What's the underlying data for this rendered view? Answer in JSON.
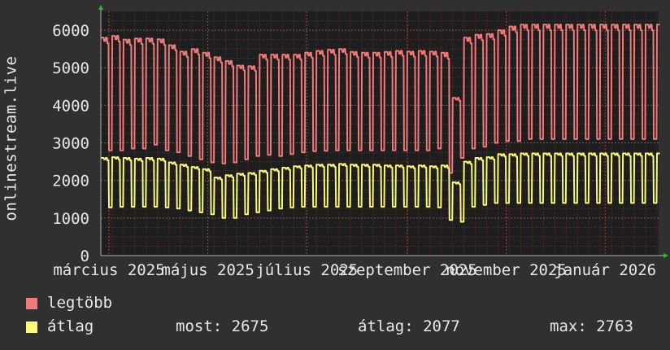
{
  "chart_data": {
    "type": "line",
    "ylabel": "onlinestream.live",
    "ylim": [
      0,
      6500
    ],
    "y_ticks": [
      "0",
      "1000",
      "2000",
      "3000",
      "4000",
      "5000",
      "6000"
    ],
    "x_ticks": [
      "március 2025",
      "május 2025",
      "július 2025",
      "szeptember 2025",
      "november 2025",
      "január 2026"
    ],
    "x_tick_days": [
      5,
      66,
      127,
      189,
      250,
      311
    ],
    "x_range_days": [
      0,
      344
    ],
    "grid": true,
    "series": [
      {
        "name": "legtöbb",
        "color": "#f07a7a",
        "weekly_high": [
          5800,
          5850,
          5750,
          5780,
          5780,
          5760,
          5600,
          5430,
          5500,
          5400,
          5280,
          5180,
          5060,
          5040,
          5350,
          5350,
          5350,
          5350,
          5400,
          5450,
          5480,
          5500,
          5420,
          5400,
          5400,
          5420,
          5450,
          5430,
          5450,
          5430,
          5400,
          4200,
          5800,
          5880,
          5900,
          6000,
          6100,
          6150,
          6150
        ],
        "weekly_low": [
          2800,
          2800,
          2850,
          2850,
          2950,
          2800,
          2750,
          2650,
          2560,
          2480,
          2450,
          2480,
          2560,
          2650,
          2680,
          2650,
          2700,
          2750,
          2780,
          2790,
          2800,
          2800,
          2800,
          2800,
          2800,
          2800,
          2800,
          2800,
          2800,
          2850,
          2200,
          2600,
          2850,
          2900,
          3000,
          3050,
          3050,
          3100,
          3100
        ]
      },
      {
        "name": "átlag",
        "color": "#fafa78",
        "weekly_high": [
          2600,
          2620,
          2600,
          2580,
          2600,
          2580,
          2480,
          2420,
          2360,
          2300,
          2080,
          2140,
          2180,
          2200,
          2260,
          2300,
          2340,
          2380,
          2400,
          2420,
          2420,
          2440,
          2420,
          2420,
          2420,
          2400,
          2400,
          2380,
          2400,
          2380,
          2400,
          1950,
          2500,
          2600,
          2620,
          2700,
          2700,
          2720,
          2720
        ],
        "weekly_low": [
          1280,
          1300,
          1300,
          1300,
          1300,
          1280,
          1250,
          1200,
          1150,
          1100,
          1000,
          1000,
          1100,
          1150,
          1200,
          1250,
          1280,
          1300,
          1300,
          1300,
          1300,
          1300,
          1300,
          1300,
          1300,
          1300,
          1300,
          1300,
          1300,
          1280,
          950,
          900,
          1300,
          1350,
          1400,
          1400,
          1400,
          1400,
          1400
        ]
      }
    ]
  },
  "legend": {
    "items": [
      {
        "label": "legtöbb",
        "color": "#f07a7a"
      },
      {
        "label": "átlag",
        "color": "#fafa78"
      }
    ],
    "stats": {
      "most": "most: 2675",
      "atlag": "átlag: 2077",
      "max": "max: 2763"
    }
  },
  "colors": {
    "background": "#303030",
    "plot_background": "#1e1e1e",
    "grid": "#7a3a3a",
    "axis_arrow": "#22c022",
    "text": "#e8e8e8"
  }
}
